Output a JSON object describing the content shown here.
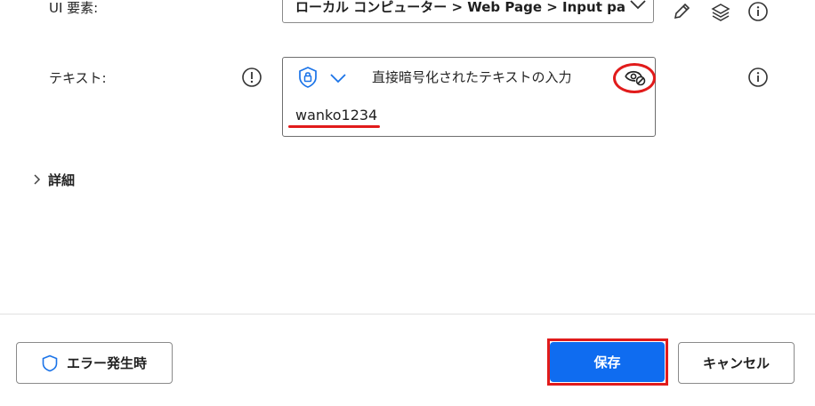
{
  "form": {
    "ui_element": {
      "label": "UI 要素:",
      "value": "ローカル コンピューター > Web Page > Input passv"
    },
    "text": {
      "label": "テキスト:",
      "mode_label": "直接暗号化されたテキストの入力",
      "value": "wanko1234"
    }
  },
  "details": {
    "label": "詳細"
  },
  "footer": {
    "on_error_label": "エラー発生時",
    "save_label": "保存",
    "cancel_label": "キャンセル"
  },
  "colors": {
    "accent": "#0f6cf0",
    "highlight": "#e11b1b",
    "border": "#8a8a8a"
  }
}
